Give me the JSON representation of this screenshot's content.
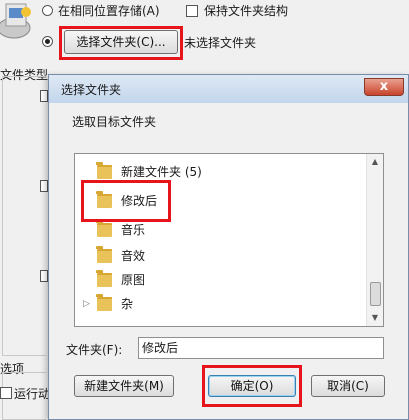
{
  "background": {
    "radio_same_location_label": "在相同位置存储(A)",
    "checkbox_keep_structure_label": "保持文件夹结构",
    "choose_folder_button_label": "选择文件夹(C)...",
    "no_folder_selected_text": "未选择文件夹",
    "file_type_label": "文件类型",
    "options_label": "选项",
    "run_label": "运行动"
  },
  "dialog": {
    "title": "选择文件夹",
    "instruction": "选取目标文件夹",
    "close_label": "x",
    "tree_items": [
      {
        "label": "新建文件夹 (5)",
        "has_children": false
      },
      {
        "label": "修改后",
        "has_children": false,
        "selected": true
      },
      {
        "label": "音乐",
        "has_children": false
      },
      {
        "label": "音效",
        "has_children": false
      },
      {
        "label": "原图",
        "has_children": false
      },
      {
        "label": "杂",
        "has_children": true
      }
    ],
    "folder_field_label": "文件夹(F):",
    "folder_field_value": "修改后",
    "new_folder_button_label": "新建文件夹(M)",
    "ok_button_label": "确定(O)",
    "cancel_button_label": "取消(C)"
  },
  "colors": {
    "highlight_red": "#e8141b",
    "folder_yellow": "#e9c25a",
    "titlebar_blue": "#c3d6ec",
    "close_red": "#c8442c"
  }
}
